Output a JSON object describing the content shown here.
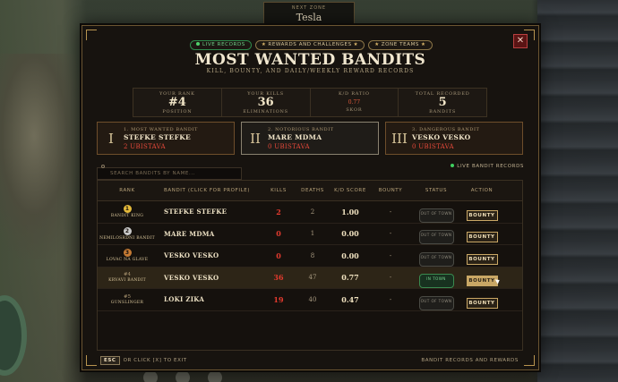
{
  "hud": {
    "next_zone_label": "NEXT ZONE",
    "next_zone_value": "Tesla"
  },
  "tabs": [
    {
      "label": "LIVE RECORDS",
      "active": true
    },
    {
      "label": "REWARDS AND CHALLENGES",
      "active": false
    },
    {
      "label": "ZONE TEAMS",
      "active": false
    }
  ],
  "header": {
    "title": "MOST WANTED BANDITS",
    "subtitle": "KILL, BOUNTY, AND DAILY/WEEKLY REWARD RECORDS",
    "close_label": "✕"
  },
  "stats": [
    {
      "label": "YOUR RANK",
      "value": "#4",
      "sub": "POSITION"
    },
    {
      "label": "YOUR KILLS",
      "value": "36",
      "sub": "ELIMINATIONS"
    },
    {
      "label": "K/D RATIO",
      "value": "0.77",
      "sub": "SKOR"
    },
    {
      "label": "TOTAL RECORDED",
      "value": "5",
      "sub": "BANDITS"
    }
  ],
  "podium": [
    {
      "roman": "I",
      "label": "1. MOST WANTED BANDIT",
      "name": "Stefke Stefke",
      "kills": "2 UBISTAVA"
    },
    {
      "roman": "II",
      "label": "2. NOTORIOUS BANDIT",
      "name": "Mare Mdma",
      "kills": "0 UBISTAVA"
    },
    {
      "roman": "III",
      "label": "3. DANGEROUS BANDIT",
      "name": "Vesko Vesko",
      "kills": "0 UBISTAVA"
    }
  ],
  "search": {
    "placeholder": "SEARCH BANDITS BY NAME..."
  },
  "live_label": "LIVE BANDIT RECORDS",
  "table": {
    "headers": {
      "rank": "RANK",
      "bandit": "BANDIT (CLICK FOR PROFILE)",
      "kills": "KILLS",
      "deaths": "DEATHS",
      "kd": "K/D SCORE",
      "bounty": "BOUNTY",
      "status": "STATUS",
      "action": "ACTION"
    },
    "rows": [
      {
        "rank": "1",
        "title": "BANDIT KING",
        "name": "Stefke Stefke",
        "kills": "2",
        "deaths": "2",
        "kd": "1.00",
        "bounty": "-",
        "status": "OUT OF TOWN",
        "action": "BOUNTY"
      },
      {
        "rank": "2",
        "title": "NEMILOSRDNI BANDIT",
        "name": "Mare Mdma",
        "kills": "0",
        "deaths": "1",
        "kd": "0.00",
        "bounty": "-",
        "status": "OUT OF TOWN",
        "action": "BOUNTY"
      },
      {
        "rank": "3",
        "title": "LOVAC NA GLAVE",
        "name": "Vesko Vesko",
        "kills": "0",
        "deaths": "8",
        "kd": "0.00",
        "bounty": "-",
        "status": "OUT OF TOWN",
        "action": "BOUNTY"
      },
      {
        "rank": "#4",
        "title": "KRVAVI BANDIT",
        "name": "Vesko Vesko",
        "kills": "36",
        "deaths": "47",
        "kd": "0.77",
        "bounty": "-",
        "status": "IN TOWN",
        "action": "BOUNTY"
      },
      {
        "rank": "#5",
        "title": "GUNSLINGER",
        "name": "Loki Zika",
        "kills": "19",
        "deaths": "40",
        "kd": "0.47",
        "bounty": "-",
        "status": "OUT OF TOWN",
        "action": "BOUNTY"
      }
    ]
  },
  "footer": {
    "esc": "ESC",
    "hint": "OR CLICK [X] TO EXIT",
    "right": "BANDIT RECORDS AND REWARDS"
  },
  "colors": {
    "accent_gold": "#c9a765",
    "kills_red": "#e33a2e",
    "live_green": "#3fcf5f"
  }
}
